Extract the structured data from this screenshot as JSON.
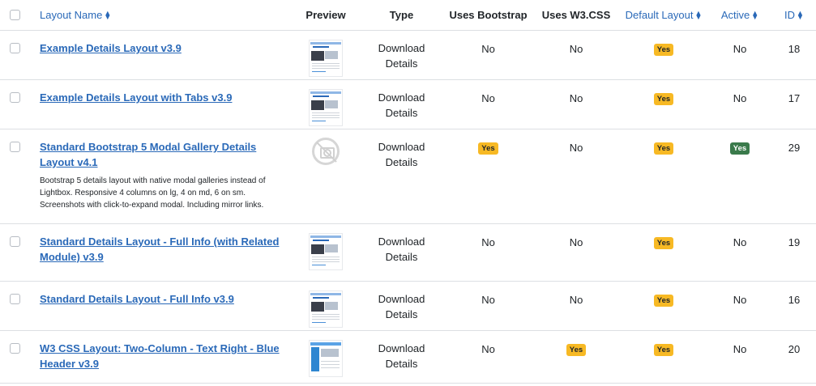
{
  "columns": {
    "layout_name": "Layout Name",
    "preview": "Preview",
    "type": "Type",
    "uses_bootstrap": "Uses Bootstrap",
    "uses_w3css": "Uses W3.CSS",
    "default_layout": "Default Layout",
    "active": "Active",
    "id": "ID"
  },
  "colors": {
    "link": "#2a69b8",
    "badge_yes": "#f7b924",
    "badge_active": "#3a7a4b"
  },
  "rows": [
    {
      "name": "Example Details Layout v3.9",
      "description": "",
      "preview": "thumbnail",
      "type_line1": "Download",
      "type_line2": "Details",
      "uses_bootstrap": "No",
      "uses_w3css": "No",
      "default_layout": "Yes",
      "active": "No",
      "id": "18"
    },
    {
      "name": "Example Details Layout with Tabs v3.9",
      "description": "",
      "preview": "thumbnail",
      "type_line1": "Download",
      "type_line2": "Details",
      "uses_bootstrap": "No",
      "uses_w3css": "No",
      "default_layout": "Yes",
      "active": "No",
      "id": "17"
    },
    {
      "name": "Standard Bootstrap 5 Modal Gallery Details Layout v4.1",
      "description": "Bootstrap 5 details layout with native modal galleries instead of Lightbox. Responsive 4 columns on lg, 4 on md, 6 on sm. Screenshots with click-to-expand modal. Including mirror links.",
      "preview": "no-image-icon",
      "type_line1": "Download",
      "type_line2": "Details",
      "uses_bootstrap": "Yes",
      "uses_w3css": "No",
      "default_layout": "Yes",
      "active": "Yes",
      "id": "29"
    },
    {
      "name": "Standard Details Layout - Full Info (with Related Module) v3.9",
      "description": "",
      "preview": "thumbnail",
      "type_line1": "Download",
      "type_line2": "Details",
      "uses_bootstrap": "No",
      "uses_w3css": "No",
      "default_layout": "Yes",
      "active": "No",
      "id": "19"
    },
    {
      "name": "Standard Details Layout - Full Info v3.9",
      "description": "",
      "preview": "thumbnail",
      "type_line1": "Download",
      "type_line2": "Details",
      "uses_bootstrap": "No",
      "uses_w3css": "No",
      "default_layout": "Yes",
      "active": "No",
      "id": "16"
    },
    {
      "name": "W3 CSS Layout: Two-Column - Text Right - Blue Header v3.9",
      "description": "",
      "preview": "thumbnail-w3",
      "type_line1": "Download",
      "type_line2": "Details",
      "uses_bootstrap": "No",
      "uses_w3css": "Yes",
      "default_layout": "Yes",
      "active": "No",
      "id": "20"
    }
  ]
}
